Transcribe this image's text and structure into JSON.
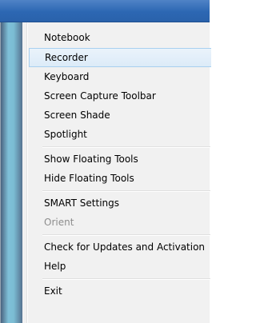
{
  "menu": {
    "group1": [
      "Notebook",
      "Recorder",
      "Keyboard",
      "Screen Capture Toolbar",
      "Screen Shade",
      "Spotlight"
    ],
    "group2": [
      "Show Floating Tools",
      "Hide Floating Tools"
    ],
    "group3": [
      "SMART Settings",
      "Orient"
    ],
    "group4": [
      "Check for Updates and Activation",
      "Help"
    ],
    "group5": [
      "Exit"
    ],
    "highlighted_item": "Recorder",
    "disabled_item": "Orient"
  },
  "colors": {
    "titlebar": "#2c67b3",
    "menu_background": "#f1f1f1",
    "hover_border": "#a8d0ef",
    "disabled_text": "#8d8d8d",
    "side_strip": "#7bbcd3"
  }
}
